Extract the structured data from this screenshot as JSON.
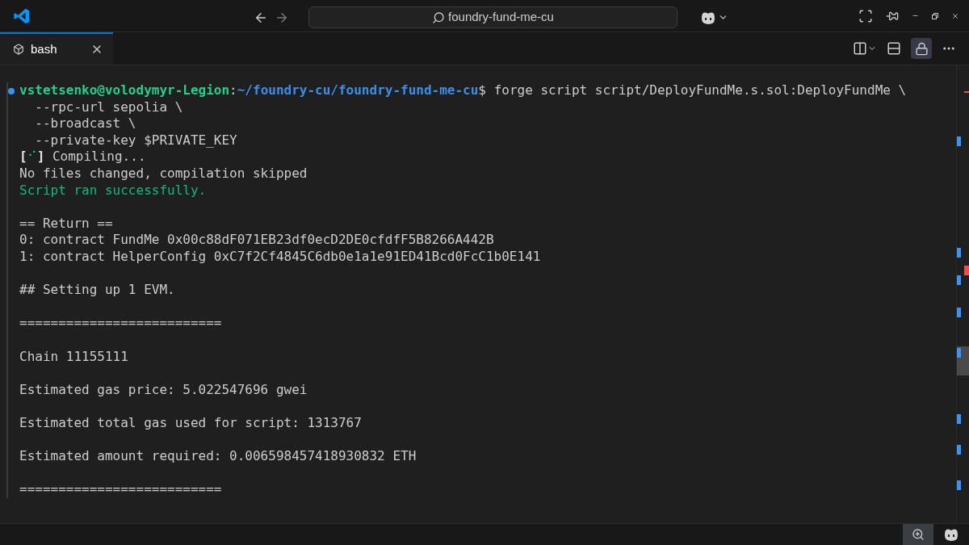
{
  "title_bar": {
    "search": "foundry-fund-me-cu"
  },
  "tabs": [
    {
      "label": "bash",
      "selected": true
    }
  ],
  "terminal": {
    "blocks": [
      [
        {
          "prompt": true,
          "segments": [
            {
              "kind": "user",
              "text": "vstetsenko@volodymyr-Legion"
            },
            {
              "kind": "plain",
              "text": ":"
            },
            {
              "kind": "path",
              "text": "~/foundry-cu/foundry-fund-me-cu"
            },
            {
              "kind": "plain",
              "text": "$ forge script script/DeployFundMe.s.sol:DeployFundMe \\"
            }
          ]
        },
        {
          "prompt": false,
          "segments": [
            {
              "kind": "plain",
              "text": "  --rpc-url sepolia \\"
            }
          ]
        },
        {
          "prompt": false,
          "segments": [
            {
              "kind": "plain",
              "text": "  --broadcast \\"
            }
          ]
        },
        {
          "prompt": false,
          "segments": [
            {
              "kind": "plain",
              "text": "  --private-key $PRIVATE_KEY"
            }
          ]
        },
        {
          "prompt": false,
          "segments": [
            {
              "kind": "bright",
              "text": "["
            },
            {
              "kind": "success",
              "text": "⠊"
            },
            {
              "kind": "bright",
              "text": "]"
            },
            {
              "kind": "plain",
              "text": " Compiling..."
            }
          ]
        },
        {
          "prompt": false,
          "segments": [
            {
              "kind": "plain",
              "text": "No files changed, compilation skipped"
            }
          ]
        },
        {
          "prompt": false,
          "segments": [
            {
              "kind": "success",
              "text": "Script ran successfully."
            }
          ]
        }
      ],
      [
        {
          "prompt": false,
          "segments": [
            {
              "kind": "plain",
              "text": "== Return =="
            }
          ]
        },
        {
          "prompt": false,
          "segments": [
            {
              "kind": "plain",
              "text": "0: contract FundMe 0x00c88dF071EB23df0ecD2DE0cfdfF5B8266A442B"
            }
          ]
        },
        {
          "prompt": false,
          "segments": [
            {
              "kind": "plain",
              "text": "1: contract HelperConfig 0xC7f2Cf4845C6db0e1a1e91ED41Bcd0FcC1b0E141"
            }
          ]
        }
      ],
      [
        {
          "prompt": false,
          "segments": [
            {
              "kind": "plain",
              "text": "## Setting up 1 EVM."
            }
          ]
        }
      ],
      [
        {
          "prompt": false,
          "segments": [
            {
              "kind": "plain",
              "text": "=========================="
            }
          ]
        }
      ],
      [
        {
          "prompt": false,
          "segments": [
            {
              "kind": "plain",
              "text": "Chain 11155111"
            }
          ]
        }
      ],
      [
        {
          "prompt": false,
          "segments": [
            {
              "kind": "plain",
              "text": "Estimated gas price: 5.022547696 gwei"
            }
          ]
        }
      ],
      [
        {
          "prompt": false,
          "segments": [
            {
              "kind": "plain",
              "text": "Estimated total gas used for script: 1313767"
            }
          ]
        }
      ],
      [
        {
          "prompt": false,
          "segments": [
            {
              "kind": "plain",
              "text": "Estimated amount required: 0.006598457418930832 ETH"
            }
          ]
        }
      ],
      [
        {
          "prompt": false,
          "segments": [
            {
              "kind": "plain",
              "text": "=========================="
            }
          ]
        }
      ]
    ]
  }
}
